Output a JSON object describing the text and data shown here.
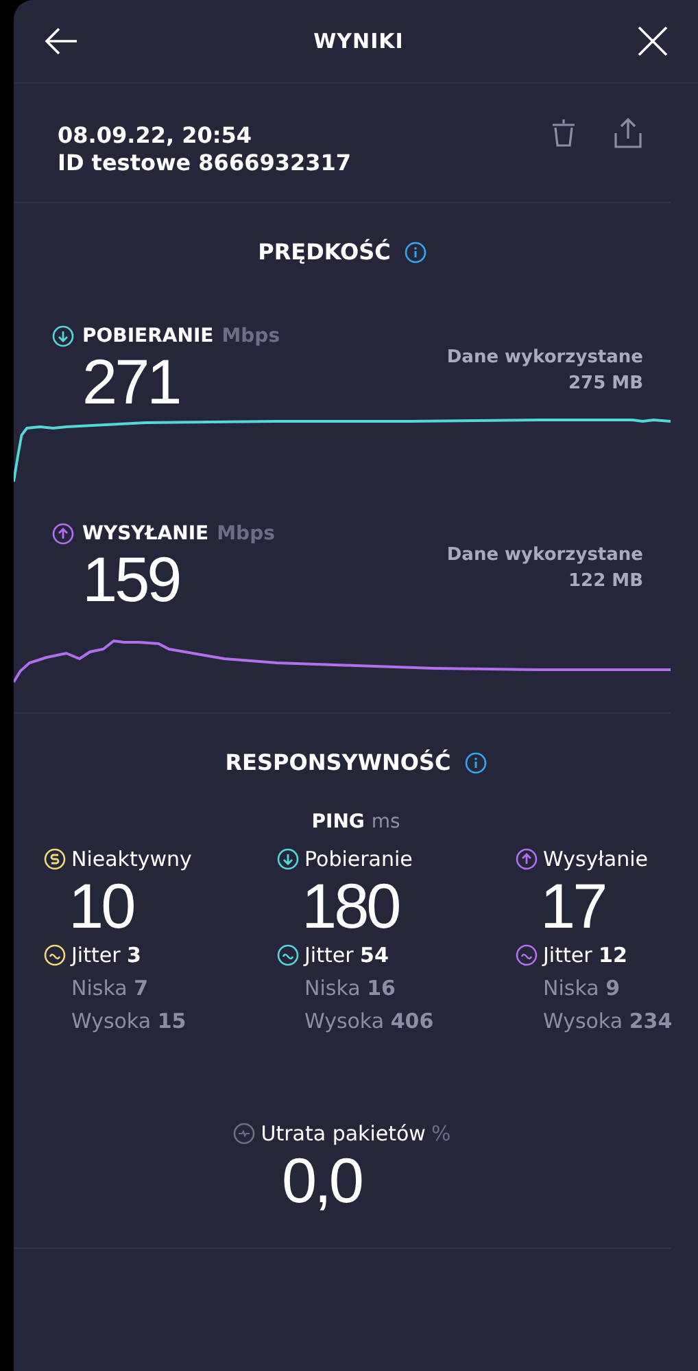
{
  "header": {
    "title": "WYNIKI"
  },
  "result": {
    "date": "08.09.22, 20:54",
    "test_id": "ID testowe 8666932317"
  },
  "speed": {
    "title": "PRĘDKOŚĆ",
    "metrics": [
      {
        "kind": "download",
        "label": "POBIERANIE",
        "unit": "Mbps",
        "value": "271",
        "data_label": "Dane wykorzystane",
        "data_value": "275 MB",
        "color": "#52d9d6"
      },
      {
        "kind": "upload",
        "label": "WYSYŁANIE",
        "unit": "Mbps",
        "value": "159",
        "data_label": "Dane wykorzystane",
        "data_value": "122 MB",
        "color": "#b36ef0"
      }
    ]
  },
  "responsiveness": {
    "title": "RESPONSYWNOŚĆ",
    "ping_label": "PING",
    "ping_unit": "ms",
    "columns": [
      {
        "kind": "idle",
        "label": "Nieaktywny",
        "value": "10",
        "jitter": "Jitter **3**",
        "low": "Niska **7**",
        "high": "Wysoka **15**",
        "color": "#f2d97a"
      },
      {
        "kind": "download",
        "label": "Pobieranie",
        "value": "180",
        "jitter": "Jitter **54**",
        "low": "Niska **16**",
        "high": "Wysoka **406**",
        "color": "#52d9d6"
      },
      {
        "kind": "upload",
        "label": "Wysyłanie",
        "value": "17",
        "jitter": "Jitter **12**",
        "low": "Niska **9**",
        "high": "Wysoka **234**",
        "color": "#b36ef0"
      }
    ]
  },
  "packet_loss": {
    "label": "Utrata pakietów",
    "unit": "%",
    "value": "0,0"
  }
}
